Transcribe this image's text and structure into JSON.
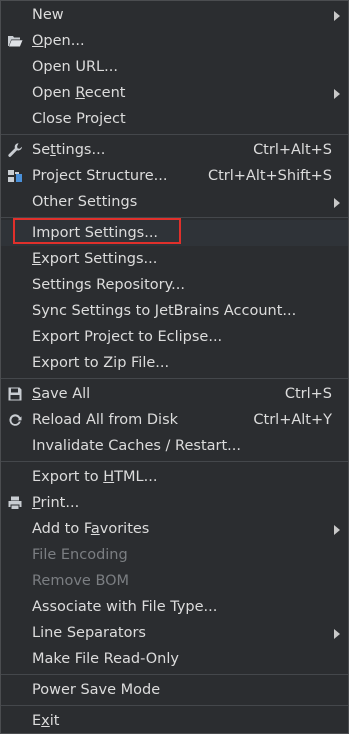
{
  "menu": {
    "items": [
      {
        "pre": "",
        "u": "",
        "post": "New",
        "submenu": true
      },
      {
        "pre": "",
        "u": "O",
        "post": "pen...",
        "icon": "folder-open-icon"
      },
      {
        "pre": "Open URL...",
        "u": "",
        "post": ""
      },
      {
        "pre": "Open ",
        "u": "R",
        "post": "ecent",
        "submenu": true
      },
      {
        "pre": "Close Project",
        "u": "",
        "post": ""
      },
      {
        "pre": "Se",
        "u": "t",
        "post": "tings...",
        "shortcut": "Ctrl+Alt+S",
        "icon": "wrench-icon"
      },
      {
        "pre": "Project Structure...",
        "u": "",
        "post": "",
        "shortcut": "Ctrl+Alt+Shift+S",
        "icon": "project-structure-icon"
      },
      {
        "pre": "Other Settings",
        "u": "",
        "post": "",
        "submenu": true
      },
      {
        "pre": "Import Settings...",
        "u": "",
        "post": ""
      },
      {
        "pre": "",
        "u": "E",
        "post": "xport Settings..."
      },
      {
        "pre": "Settings Repository...",
        "u": "",
        "post": ""
      },
      {
        "pre": "Sync Settings to JetBrains Account...",
        "u": "",
        "post": ""
      },
      {
        "pre": "Export Project to Eclipse...",
        "u": "",
        "post": ""
      },
      {
        "pre": "Export to Zip File...",
        "u": "",
        "post": ""
      },
      {
        "pre": "",
        "u": "S",
        "post": "ave All",
        "shortcut": "Ctrl+S",
        "icon": "save-icon"
      },
      {
        "pre": "Reload All from Disk",
        "u": "",
        "post": "",
        "shortcut": "Ctrl+Alt+Y",
        "icon": "reload-icon"
      },
      {
        "pre": "Invalidate Caches / Restart...",
        "u": "",
        "post": ""
      },
      {
        "pre": "Export to ",
        "u": "H",
        "post": "TML..."
      },
      {
        "pre": "",
        "u": "P",
        "post": "rint...",
        "icon": "printer-icon"
      },
      {
        "pre": "Add to F",
        "u": "a",
        "post": "vorites",
        "submenu": true
      },
      {
        "pre": "File Encoding",
        "u": "",
        "post": "",
        "disabled": true
      },
      {
        "pre": "Remove BOM",
        "u": "",
        "post": "",
        "disabled": true
      },
      {
        "pre": "Associate with File Type...",
        "u": "",
        "post": ""
      },
      {
        "pre": "Line Separators",
        "u": "",
        "post": "",
        "submenu": true
      },
      {
        "pre": "Make File Read-Only",
        "u": "",
        "post": ""
      },
      {
        "pre": "Power Save Mode",
        "u": "",
        "post": ""
      },
      {
        "pre": "E",
        "u": "x",
        "post": "it"
      }
    ]
  },
  "colors": {
    "background": "#2b2d30",
    "text": "#dcdcdc",
    "disabled_text": "#7b7e82",
    "separator": "#44474b",
    "highlight_box": "#e0302b"
  }
}
